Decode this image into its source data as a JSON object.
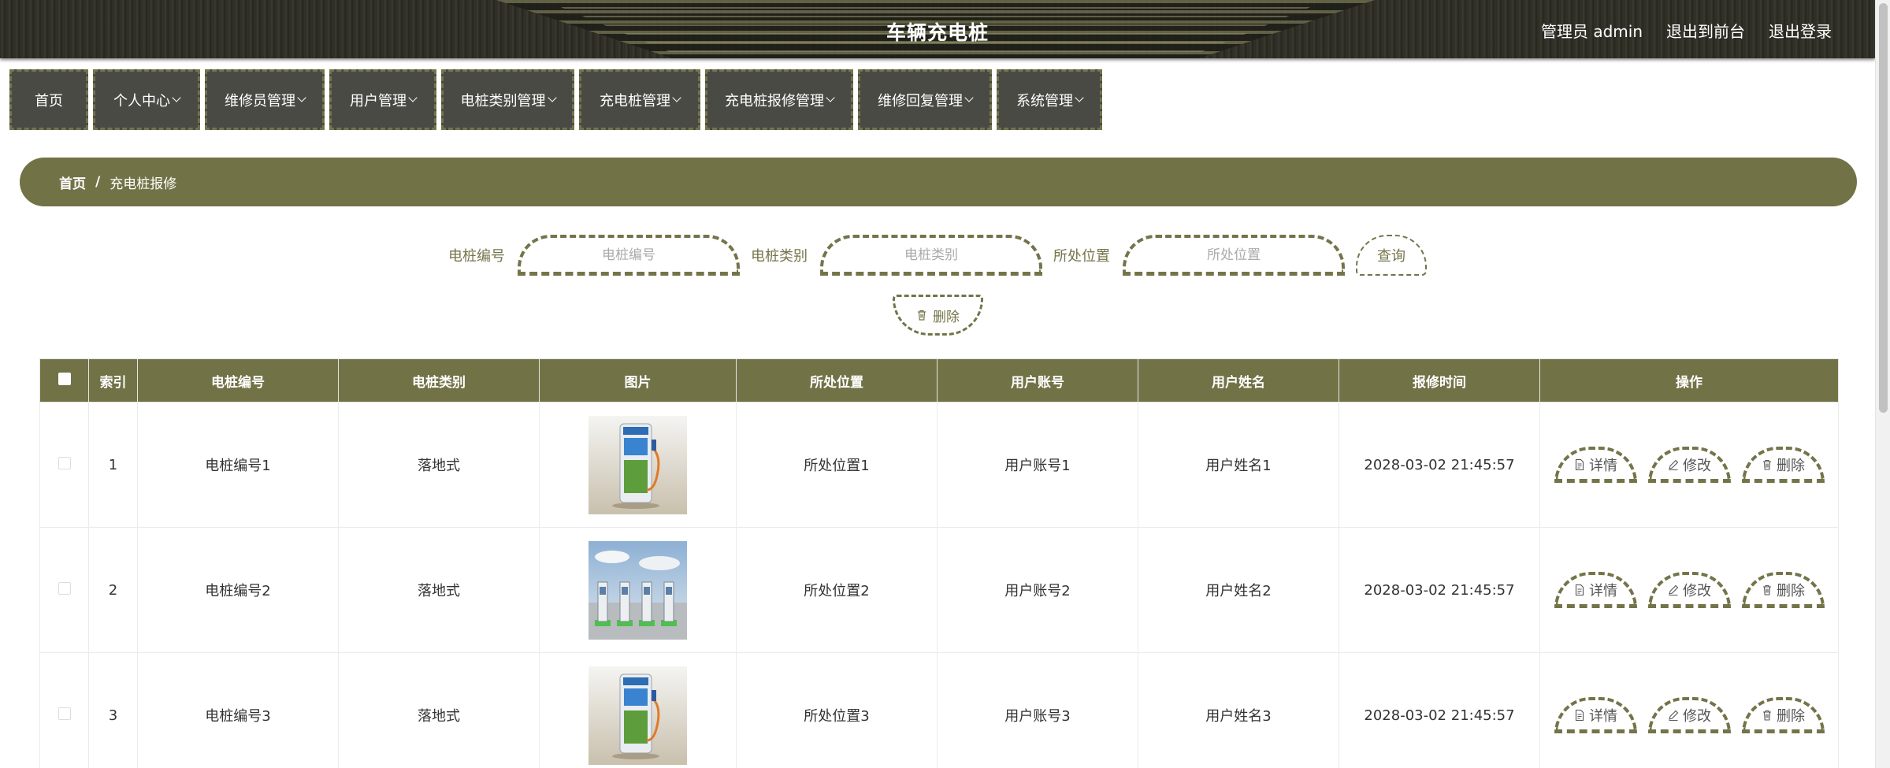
{
  "header": {
    "title": "车辆充电桩",
    "user_label": "管理员 admin",
    "front_link": "退出到前台",
    "logout_link": "退出登录"
  },
  "nav": [
    {
      "label": "首页",
      "dropdown": false,
      "width": 100
    },
    {
      "label": "个人中心",
      "dropdown": true,
      "width": 136
    },
    {
      "label": "维修员管理",
      "dropdown": true,
      "width": 152
    },
    {
      "label": "用户管理",
      "dropdown": true,
      "width": 136
    },
    {
      "label": "电桩类别管理",
      "dropdown": true,
      "width": 169
    },
    {
      "label": "充电桩管理",
      "dropdown": true,
      "width": 154
    },
    {
      "label": "充电桩报修管理",
      "dropdown": true,
      "width": 188
    },
    {
      "label": "维修回复管理",
      "dropdown": true,
      "width": 170
    },
    {
      "label": "系统管理",
      "dropdown": true,
      "width": 134
    }
  ],
  "breadcrumb": {
    "home": "首页",
    "separator": "/",
    "current": "充电桩报修"
  },
  "search": {
    "fields": [
      {
        "label": "电桩编号",
        "placeholder": "电桩编号"
      },
      {
        "label": "电桩类别",
        "placeholder": "电桩类别"
      },
      {
        "label": "所处位置",
        "placeholder": "所处位置"
      }
    ],
    "query_button": "查询",
    "delete_button": "删除"
  },
  "table": {
    "columns": [
      "索引",
      "电桩编号",
      "电桩类别",
      "图片",
      "所处位置",
      "用户账号",
      "用户姓名",
      "报修时间",
      "操作"
    ],
    "rows": [
      {
        "index": "1",
        "code": "电桩编号1",
        "category": "落地式",
        "image": "charger-standing",
        "location": "所处位置1",
        "account": "用户账号1",
        "name": "用户姓名1",
        "time": "2028-03-02 21:45:57"
      },
      {
        "index": "2",
        "code": "电桩编号2",
        "category": "落地式",
        "image": "charger-outdoor-station",
        "location": "所处位置2",
        "account": "用户账号2",
        "name": "用户姓名2",
        "time": "2028-03-02 21:45:57"
      },
      {
        "index": "3",
        "code": "电桩编号3",
        "category": "落地式",
        "image": "charger-standing",
        "location": "所处位置3",
        "account": "用户账号3",
        "name": "用户姓名3",
        "time": "2028-03-02 21:45:57"
      }
    ],
    "actions": {
      "detail": "详情",
      "edit": "修改",
      "delete": "删除"
    }
  },
  "colors": {
    "accent": "#727247",
    "dashed": "#74744a"
  }
}
